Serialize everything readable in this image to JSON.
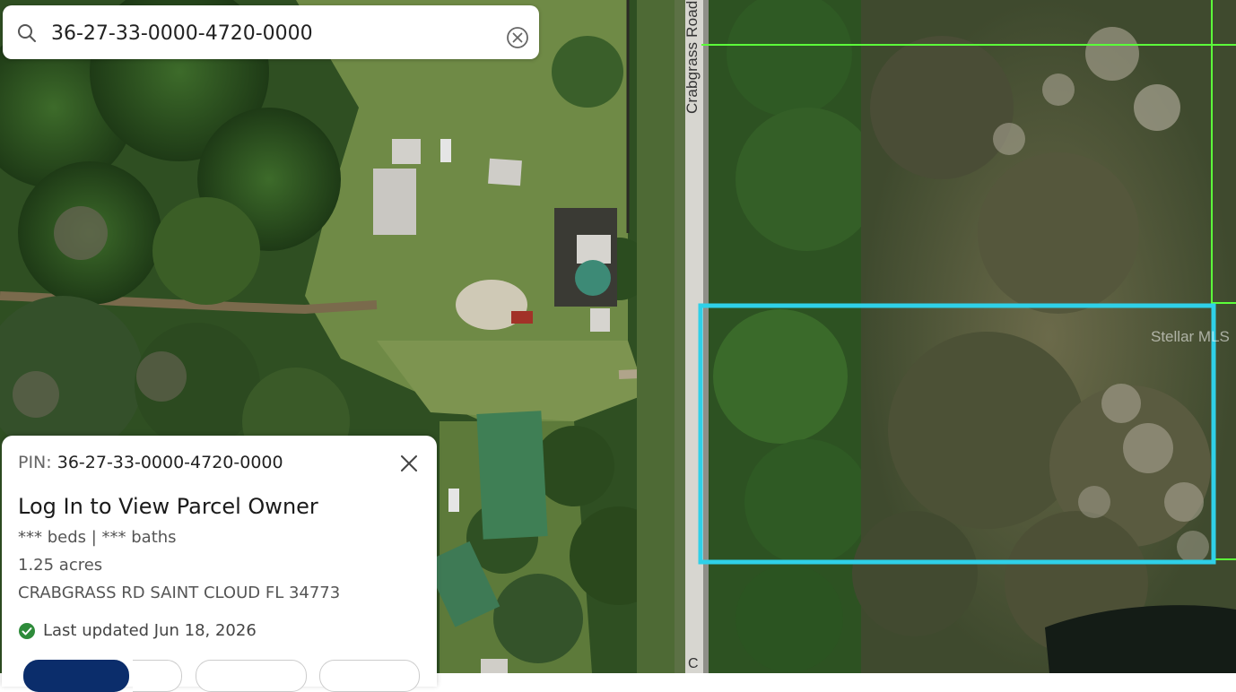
{
  "search": {
    "value": "36-27-33-0000-4720-0000"
  },
  "map": {
    "road_label": "Crabgrass Road",
    "road_label_bottom": "C",
    "watermark": "Stellar MLS",
    "highlight_color": "#2fd0e8",
    "parcel_line_color": "#5cff3a"
  },
  "card": {
    "pin_label": "PIN:",
    "pin_value": "36-27-33-0000-4720-0000",
    "owner_title": "Log In to View Parcel Owner",
    "beds_baths": "*** beds | *** baths",
    "acres": "1.25 acres",
    "address": "CRABGRASS RD SAINT CLOUD FL 34773",
    "last_updated": "Last updated Jun 18, 2026",
    "status_color": "#2e8b3a"
  }
}
